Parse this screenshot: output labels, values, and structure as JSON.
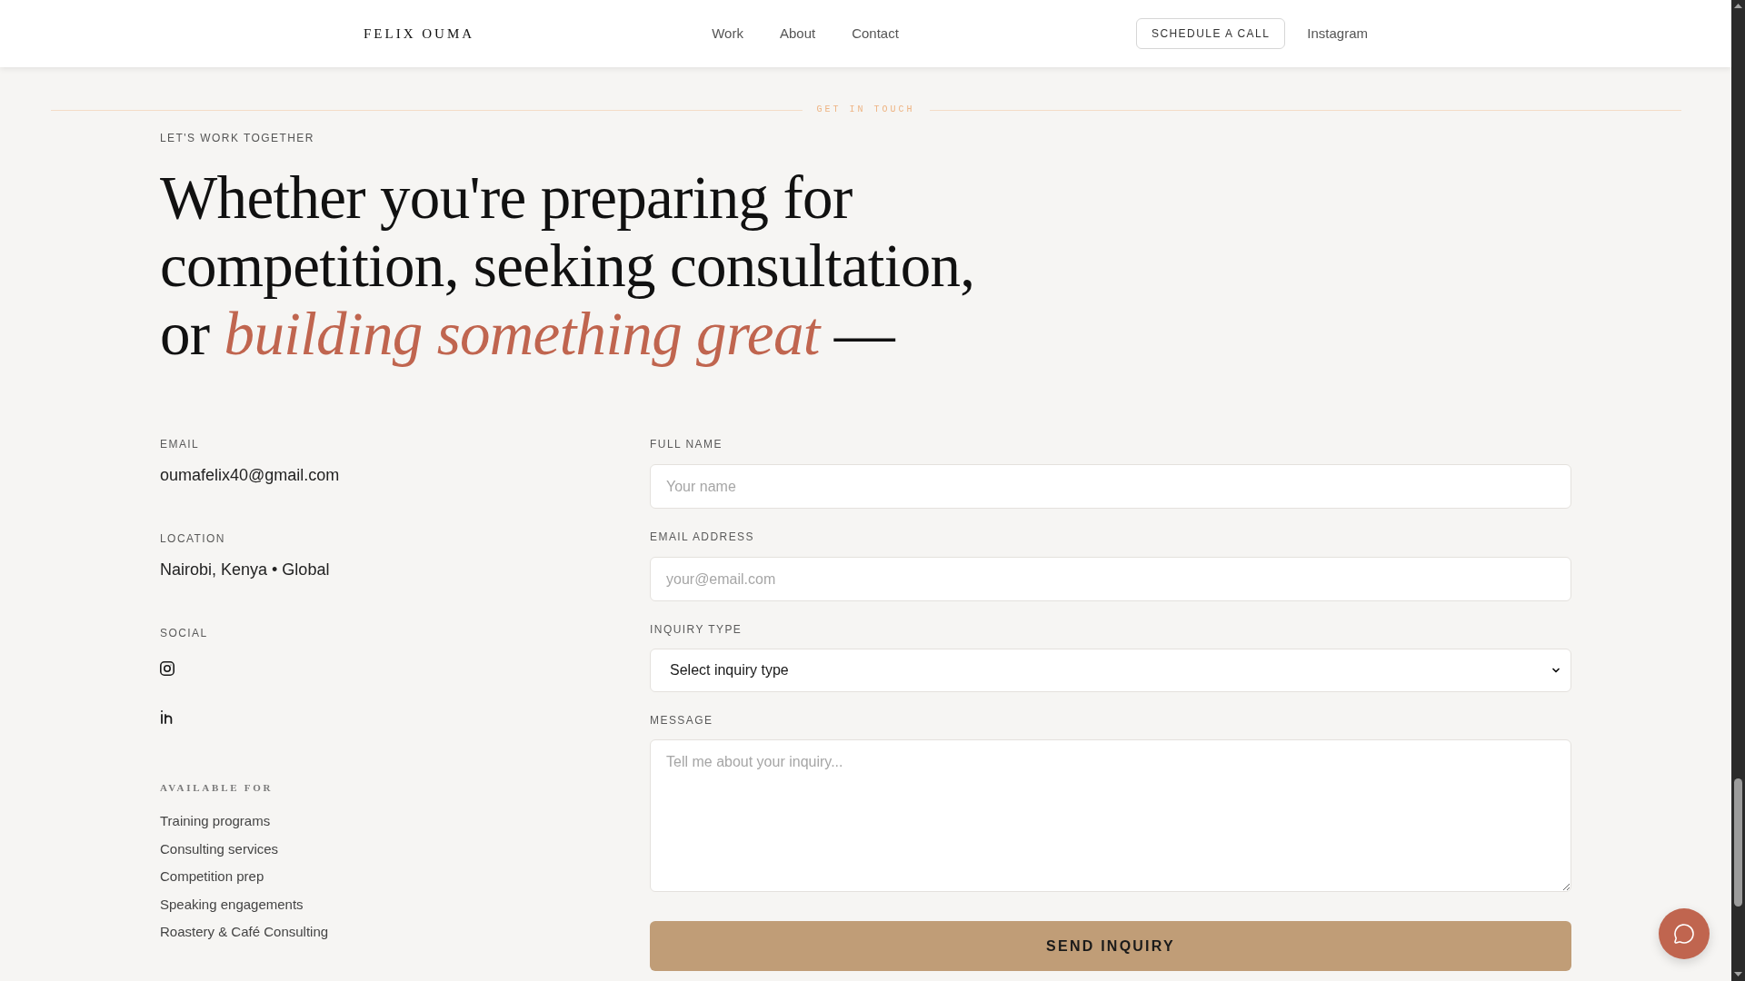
{
  "header": {
    "logo": "FELIX OUMA",
    "nav": [
      "Work",
      "About",
      "Contact"
    ],
    "cta_button": "SCHEDULE A CALL",
    "instagram_link": "Instagram"
  },
  "divider_label": "GET IN TOUCH",
  "eyebrow": "LET'S WORK TOGETHER",
  "headline": "Whether you're preparing for competition, seeking consultation, or *building something great* —",
  "contact_info": [
    {
      "label": "EMAIL",
      "value": "oumafelix40@gmail.com"
    },
    {
      "label": "LOCATION",
      "value": "Nairobi, Kenya • Global"
    }
  ],
  "social": {
    "label": "SOCIAL"
  },
  "available_for": {
    "title": "AVAILABLE FOR",
    "items": [
      "Training programs",
      "Consulting services",
      "Competition prep",
      "Speaking engagements",
      "Roastery & Café Consulting"
    ]
  },
  "form": {
    "fields": [
      {
        "kind": "input",
        "label": "FULL NAME",
        "placeholder": "Your name"
      },
      {
        "kind": "input",
        "label": "EMAIL ADDRESS",
        "placeholder": "your@email.com"
      },
      {
        "kind": "select",
        "label": "INQUIRY TYPE",
        "value": "Select inquiry type"
      },
      {
        "kind": "textarea",
        "label": "MESSAGE",
        "placeholder": "Tell me about your inquiry..."
      }
    ],
    "submit": "SEND INQUIRY"
  }
}
